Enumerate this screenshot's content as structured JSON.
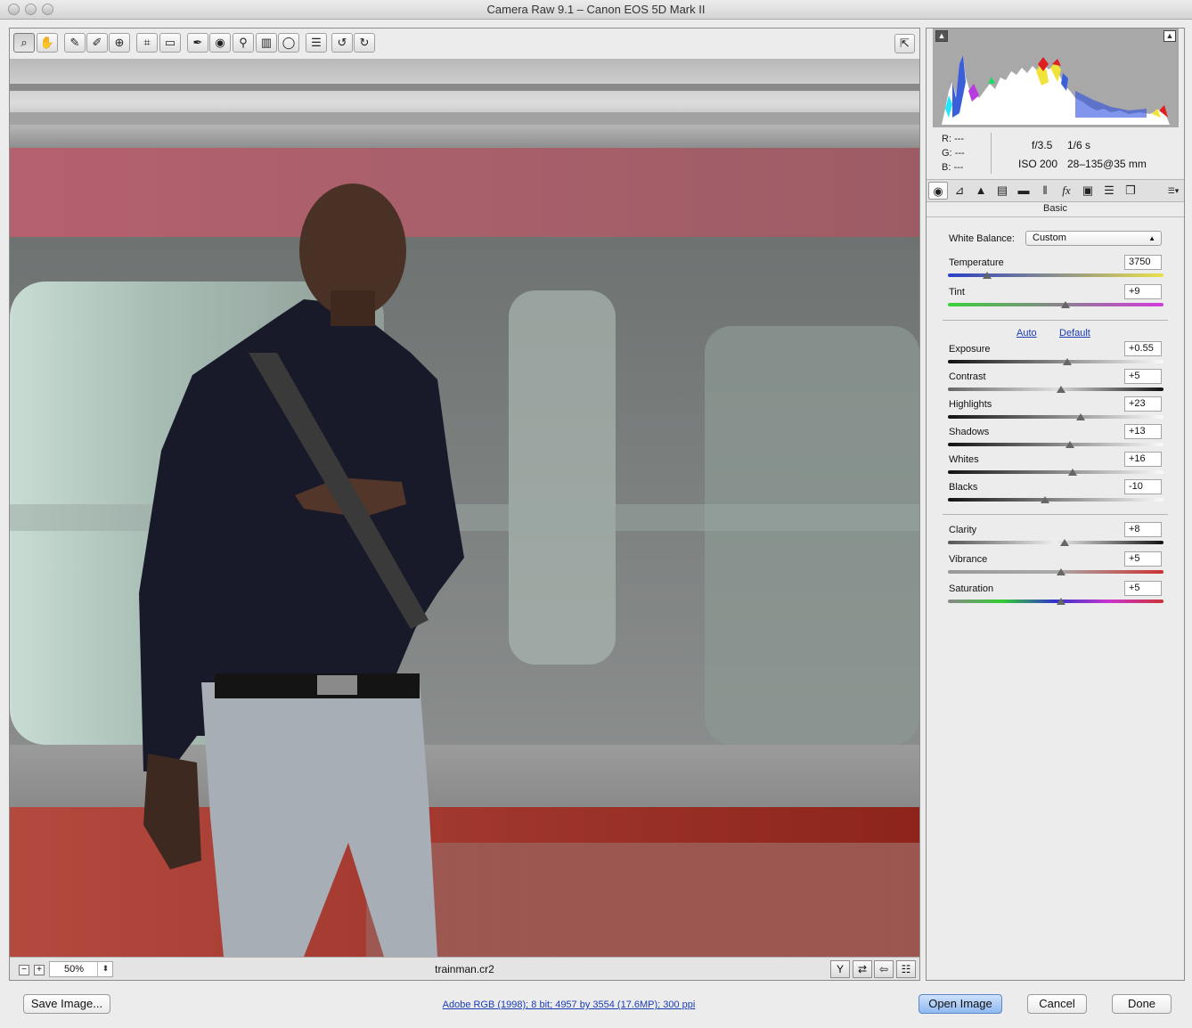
{
  "window": {
    "title": "Camera Raw 9.1  –  Canon EOS 5D Mark II"
  },
  "toolbar": {
    "tools": [
      {
        "name": "zoom-tool",
        "icon": "magnifier-icon",
        "glyph": "⌕"
      },
      {
        "name": "hand-tool",
        "icon": "hand-icon",
        "glyph": "✋"
      },
      {
        "name": "white-balance-tool",
        "icon": "eyedropper-icon",
        "glyph": "✎"
      },
      {
        "name": "color-sampler-tool",
        "icon": "color-sampler-icon",
        "glyph": "✐"
      },
      {
        "name": "targeted-adjustment-tool",
        "icon": "target-adjust-icon",
        "glyph": "⊕"
      },
      {
        "name": "crop-tool",
        "icon": "crop-icon",
        "glyph": "⌗"
      },
      {
        "name": "straighten-tool",
        "icon": "level-icon",
        "glyph": "▭"
      },
      {
        "name": "spot-removal-tool",
        "icon": "spot-removal-icon",
        "glyph": "✒"
      },
      {
        "name": "red-eye-tool",
        "icon": "eye-icon",
        "glyph": "◉"
      },
      {
        "name": "adjustment-brush-tool",
        "icon": "brush-icon",
        "glyph": "⚲"
      },
      {
        "name": "graduated-filter-tool",
        "icon": "graduated-filter-icon",
        "glyph": "▥"
      },
      {
        "name": "radial-filter-tool",
        "icon": "radial-filter-icon",
        "glyph": "◯"
      },
      {
        "name": "preferences-tool",
        "icon": "list-icon",
        "glyph": "☰"
      },
      {
        "name": "rotate-ccw-tool",
        "icon": "rotate-left-icon",
        "glyph": "↺"
      },
      {
        "name": "rotate-cw-tool",
        "icon": "rotate-right-icon",
        "glyph": "↻"
      }
    ],
    "fullscreen_icon": "fullscreen-icon"
  },
  "preview": {
    "zoom": "50%",
    "filename": "trainman.cr2"
  },
  "histogram": {
    "rgb": [
      {
        "label": "R:",
        "value": "---"
      },
      {
        "label": "G:",
        "value": "---"
      },
      {
        "label": "B:",
        "value": "---"
      }
    ],
    "aperture": "f/3.5",
    "shutter": "1/6 s",
    "iso": "ISO 200",
    "lens": "28–135@35 mm"
  },
  "panel": {
    "title": "Basic",
    "white_balance_label": "White Balance:",
    "white_balance_value": "Custom",
    "auto_label": "Auto",
    "default_label": "Default",
    "sliders": [
      {
        "key": "temperature",
        "label": "Temperature",
        "value": "3750",
        "pos": 0.18
      },
      {
        "key": "tint",
        "label": "Tint",
        "value": "+9",
        "pos": 0.545
      },
      {
        "key": "exposure",
        "label": "Exposure",
        "value": "+0.55",
        "pos": 0.555
      },
      {
        "key": "contrast",
        "label": "Contrast",
        "value": "+5",
        "pos": 0.525
      },
      {
        "key": "highlights",
        "label": "Highlights",
        "value": "+23",
        "pos": 0.615
      },
      {
        "key": "shadows",
        "label": "Shadows",
        "value": "+13",
        "pos": 0.565
      },
      {
        "key": "whites",
        "label": "Whites",
        "value": "+16",
        "pos": 0.58
      },
      {
        "key": "blacks",
        "label": "Blacks",
        "value": "-10",
        "pos": 0.45
      },
      {
        "key": "clarity",
        "label": "Clarity",
        "value": "+8",
        "pos": 0.54
      },
      {
        "key": "vibrance",
        "label": "Vibrance",
        "value": "+5",
        "pos": 0.525
      },
      {
        "key": "saturation",
        "label": "Saturation",
        "value": "+5",
        "pos": 0.525
      }
    ]
  },
  "bottom": {
    "save_label": "Save Image...",
    "workflow_label": "Adobe RGB (1998); 8 bit; 4957 by 3554 (17.6MP); 300 ppi",
    "open_label": "Open Image",
    "cancel_label": "Cancel",
    "done_label": "Done"
  }
}
